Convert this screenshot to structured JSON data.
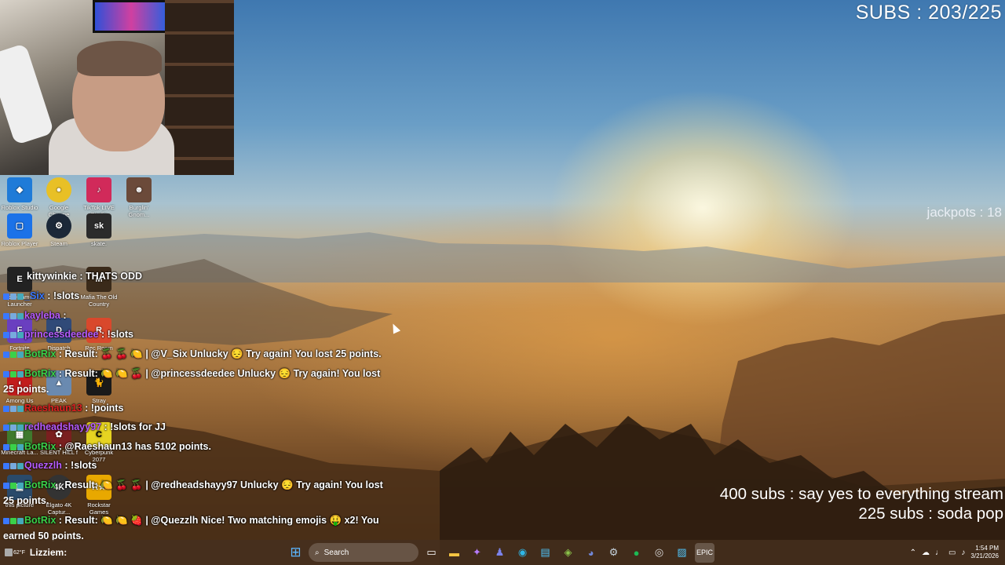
{
  "overlay": {
    "subs_counter": "SUBS : 203/225",
    "jackpots": "jackpots : 18",
    "goals": [
      "400 subs :  say yes to everything stream",
      "225 subs : soda pop"
    ]
  },
  "desktop_icons": [
    {
      "label": "Roblox Studio",
      "color": "#1f7bd8"
    },
    {
      "label": "Google Chrome",
      "color": "#e8c026"
    },
    {
      "label": "TikTok LIVE Studio",
      "color": "#d12a5a"
    },
    {
      "label": "Burglin' Gnom...",
      "color": "#6b4a3a"
    },
    {
      "label": "Roblox Player",
      "color": "#1b72e8"
    },
    {
      "label": "Steam",
      "color": "#1b2838"
    },
    {
      "label": "skate.",
      "color": "#2b2b2b"
    },
    {
      "label": "Epic Games Launcher",
      "color": "#222222"
    },
    {
      "label": "Mafia The Old Country",
      "color": "#3a2a1a"
    },
    {
      "label": "Fortnite",
      "color": "#6a3fc0"
    },
    {
      "label": "Dispatch",
      "color": "#304a78"
    },
    {
      "label": "Rec Room",
      "color": "#d9482c"
    },
    {
      "label": "Among Us",
      "color": "#c21c1c"
    },
    {
      "label": "PEAK",
      "color": "#6a8ab0"
    },
    {
      "label": "Stray",
      "color": "#1a1a1a"
    },
    {
      "label": "Minecraft La...",
      "color": "#3f7a2d"
    },
    {
      "label": "SILENT HILL f",
      "color": "#7a1f1f"
    },
    {
      "label": "Cyberpunk 2077",
      "color": "#e6d321"
    },
    {
      "label": "this picture",
      "color": "#2a4a6a"
    },
    {
      "label": "Elgato 4K Captur...",
      "color": "#333333"
    },
    {
      "label": "Rockstar Games",
      "color": "#e8a800"
    }
  ],
  "chat": [
    {
      "user": "kittywinkie",
      "color": "#ffffff",
      "message": " : THATS ODD"
    },
    {
      "user": "_Six",
      "color": "#3a78ff",
      "message": " : !slots"
    },
    {
      "user": "kayleba",
      "color": "#b65cff",
      "message": " :"
    },
    {
      "user": "princessdeedee",
      "color": "#b65cff",
      "message": " : !slots"
    },
    {
      "user": "BotRix",
      "color": "#3ad14a",
      "message": " : Result: 🍒 🍒 🍋 | @V_Six Unlucky 😔 Try again! You lost 25 points."
    },
    {
      "user": "BotRix",
      "color": "#3ad14a",
      "message": " : Result: 🍋 🍋 🍒 | @princessdeedee Unlucky 😔 Try again! You lost"
    },
    {
      "user": "Raeshaun13",
      "color": "#e02020",
      "message": " : !points"
    },
    {
      "user": "redheadshayy97",
      "color": "#b65cff",
      "message": " : !slots for JJ"
    },
    {
      "user": "BotRix",
      "color": "#3ad14a",
      "message": " : @Raeshaun13 has 5102 points."
    },
    {
      "user": "Quezzlh",
      "color": "#b65cff",
      "message": " : !slots"
    },
    {
      "user": "BotRix",
      "color": "#3ad14a",
      "message": " : Result: 🍋 🍒 🍒 | @redheadshayy97 Unlucky 😔 Try again! You lost"
    },
    {
      "user": "BotRix",
      "color": "#3ad14a",
      "message": " : Result: 🍋 🍋 🍓 | @Quezzlh Nice! Two matching emojis 🤑 x2! You"
    },
    {
      "user": "Lizziem",
      "color": "#ffffff",
      "message": " :"
    }
  ],
  "chat_wraps": [
    "25 points.",
    "25 points.",
    "earned 50 points."
  ],
  "taskbar": {
    "weather": "62°F",
    "search_label": "Search",
    "time": "1:54 PM",
    "date": "3/21/2026"
  }
}
